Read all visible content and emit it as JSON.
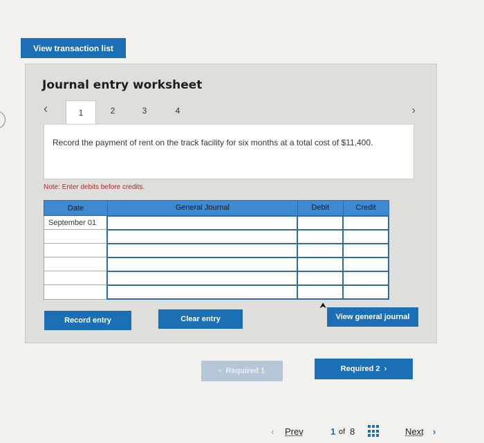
{
  "top": {
    "view_transaction_list": "View transaction list"
  },
  "worksheet": {
    "title": "Journal entry worksheet",
    "tabs": [
      "1",
      "2",
      "3",
      "4"
    ],
    "active_tab": "1",
    "question": "Record the payment of rent on the track facility for six months at a total cost of $11,400.",
    "note": "Note: Enter debits before credits.",
    "table": {
      "headers": {
        "date": "Date",
        "journal": "General Journal",
        "debit": "Debit",
        "credit": "Credit"
      },
      "rows": [
        {
          "date": "September 01"
        },
        {
          "date": ""
        },
        {
          "date": ""
        },
        {
          "date": ""
        },
        {
          "date": ""
        },
        {
          "date": ""
        }
      ]
    },
    "buttons": {
      "record": "Record entry",
      "clear": "Clear entry",
      "view_general_journal": "View general journal"
    }
  },
  "nav": {
    "required_prev": "Required 1",
    "required_next": "Required 2",
    "prev": "Prev",
    "page": "1",
    "of": "of",
    "total": "8",
    "next": "Next"
  },
  "colors": {
    "accent": "#1a6fb5",
    "header": "#3d8ad3",
    "note": "#b12a2a"
  }
}
